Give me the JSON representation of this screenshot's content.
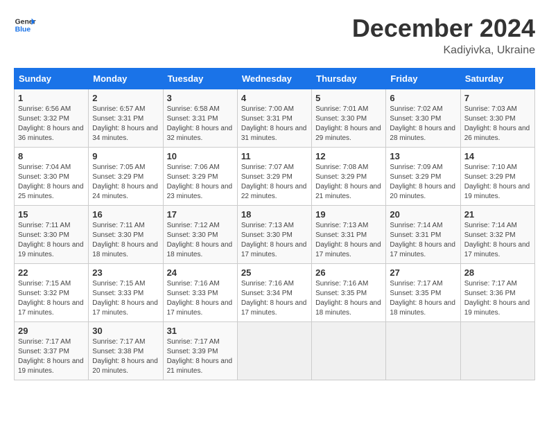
{
  "logo": {
    "line1": "General",
    "line2": "Blue"
  },
  "title": "December 2024",
  "subtitle": "Kadiyivka, Ukraine",
  "days_header": [
    "Sunday",
    "Monday",
    "Tuesday",
    "Wednesday",
    "Thursday",
    "Friday",
    "Saturday"
  ],
  "weeks": [
    [
      {
        "day": "1",
        "sunrise": "6:56 AM",
        "sunset": "3:32 PM",
        "daylight": "8 hours and 36 minutes."
      },
      {
        "day": "2",
        "sunrise": "6:57 AM",
        "sunset": "3:31 PM",
        "daylight": "8 hours and 34 minutes."
      },
      {
        "day": "3",
        "sunrise": "6:58 AM",
        "sunset": "3:31 PM",
        "daylight": "8 hours and 32 minutes."
      },
      {
        "day": "4",
        "sunrise": "7:00 AM",
        "sunset": "3:31 PM",
        "daylight": "8 hours and 31 minutes."
      },
      {
        "day": "5",
        "sunrise": "7:01 AM",
        "sunset": "3:30 PM",
        "daylight": "8 hours and 29 minutes."
      },
      {
        "day": "6",
        "sunrise": "7:02 AM",
        "sunset": "3:30 PM",
        "daylight": "8 hours and 28 minutes."
      },
      {
        "day": "7",
        "sunrise": "7:03 AM",
        "sunset": "3:30 PM",
        "daylight": "8 hours and 26 minutes."
      }
    ],
    [
      {
        "day": "8",
        "sunrise": "7:04 AM",
        "sunset": "3:30 PM",
        "daylight": "8 hours and 25 minutes."
      },
      {
        "day": "9",
        "sunrise": "7:05 AM",
        "sunset": "3:29 PM",
        "daylight": "8 hours and 24 minutes."
      },
      {
        "day": "10",
        "sunrise": "7:06 AM",
        "sunset": "3:29 PM",
        "daylight": "8 hours and 23 minutes."
      },
      {
        "day": "11",
        "sunrise": "7:07 AM",
        "sunset": "3:29 PM",
        "daylight": "8 hours and 22 minutes."
      },
      {
        "day": "12",
        "sunrise": "7:08 AM",
        "sunset": "3:29 PM",
        "daylight": "8 hours and 21 minutes."
      },
      {
        "day": "13",
        "sunrise": "7:09 AM",
        "sunset": "3:29 PM",
        "daylight": "8 hours and 20 minutes."
      },
      {
        "day": "14",
        "sunrise": "7:10 AM",
        "sunset": "3:29 PM",
        "daylight": "8 hours and 19 minutes."
      }
    ],
    [
      {
        "day": "15",
        "sunrise": "7:11 AM",
        "sunset": "3:30 PM",
        "daylight": "8 hours and 19 minutes."
      },
      {
        "day": "16",
        "sunrise": "7:11 AM",
        "sunset": "3:30 PM",
        "daylight": "8 hours and 18 minutes."
      },
      {
        "day": "17",
        "sunrise": "7:12 AM",
        "sunset": "3:30 PM",
        "daylight": "8 hours and 18 minutes."
      },
      {
        "day": "18",
        "sunrise": "7:13 AM",
        "sunset": "3:30 PM",
        "daylight": "8 hours and 17 minutes."
      },
      {
        "day": "19",
        "sunrise": "7:13 AM",
        "sunset": "3:31 PM",
        "daylight": "8 hours and 17 minutes."
      },
      {
        "day": "20",
        "sunrise": "7:14 AM",
        "sunset": "3:31 PM",
        "daylight": "8 hours and 17 minutes."
      },
      {
        "day": "21",
        "sunrise": "7:14 AM",
        "sunset": "3:32 PM",
        "daylight": "8 hours and 17 minutes."
      }
    ],
    [
      {
        "day": "22",
        "sunrise": "7:15 AM",
        "sunset": "3:32 PM",
        "daylight": "8 hours and 17 minutes."
      },
      {
        "day": "23",
        "sunrise": "7:15 AM",
        "sunset": "3:33 PM",
        "daylight": "8 hours and 17 minutes."
      },
      {
        "day": "24",
        "sunrise": "7:16 AM",
        "sunset": "3:33 PM",
        "daylight": "8 hours and 17 minutes."
      },
      {
        "day": "25",
        "sunrise": "7:16 AM",
        "sunset": "3:34 PM",
        "daylight": "8 hours and 17 minutes."
      },
      {
        "day": "26",
        "sunrise": "7:16 AM",
        "sunset": "3:35 PM",
        "daylight": "8 hours and 18 minutes."
      },
      {
        "day": "27",
        "sunrise": "7:17 AM",
        "sunset": "3:35 PM",
        "daylight": "8 hours and 18 minutes."
      },
      {
        "day": "28",
        "sunrise": "7:17 AM",
        "sunset": "3:36 PM",
        "daylight": "8 hours and 19 minutes."
      }
    ],
    [
      {
        "day": "29",
        "sunrise": "7:17 AM",
        "sunset": "3:37 PM",
        "daylight": "8 hours and 19 minutes."
      },
      {
        "day": "30",
        "sunrise": "7:17 AM",
        "sunset": "3:38 PM",
        "daylight": "8 hours and 20 minutes."
      },
      {
        "day": "31",
        "sunrise": "7:17 AM",
        "sunset": "3:39 PM",
        "daylight": "8 hours and 21 minutes."
      },
      null,
      null,
      null,
      null
    ]
  ]
}
